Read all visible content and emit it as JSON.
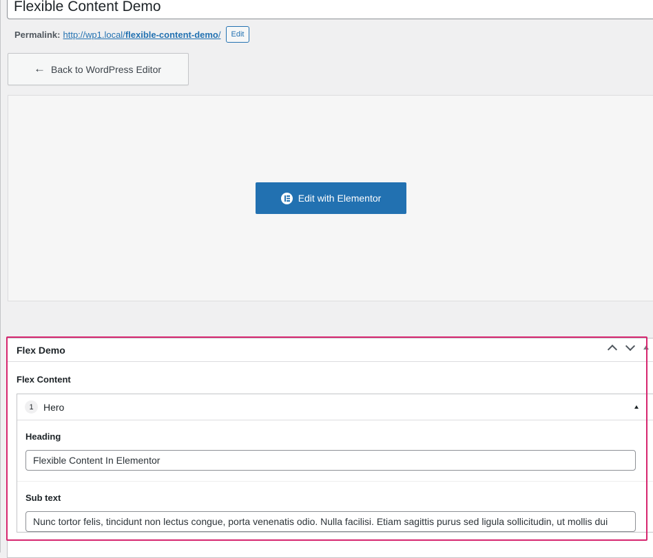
{
  "post": {
    "title": "Flexible Content Demo",
    "permalink_label": "Permalink:",
    "permalink_url_base": "http://wp1.local/",
    "permalink_slug": "flexible-content-demo",
    "permalink_trailing": "/",
    "permalink_edit": "Edit"
  },
  "back_button": {
    "arrow": "←",
    "label": "Back to WordPress Editor"
  },
  "elementor": {
    "button_label": "Edit with Elementor",
    "icon": "elementor-icon",
    "accent": "#2271b1"
  },
  "metabox": {
    "title": "Flex Demo",
    "field_label": "Flex Content",
    "layout": {
      "order": "1",
      "name": "Hero",
      "fields": {
        "heading_label": "Heading",
        "heading_value": "Flexible Content In Elementor",
        "subtext_label": "Sub text",
        "subtext_value": "Nunc tortor felis, tincidunt non lectus congue, porta venenatis odio. Nulla facilisi. Etiam sagittis purus sed ligula sollicitudin, ut mollis dui"
      }
    }
  },
  "colors": {
    "highlight": "#d6246e",
    "link": "#2271b1"
  }
}
